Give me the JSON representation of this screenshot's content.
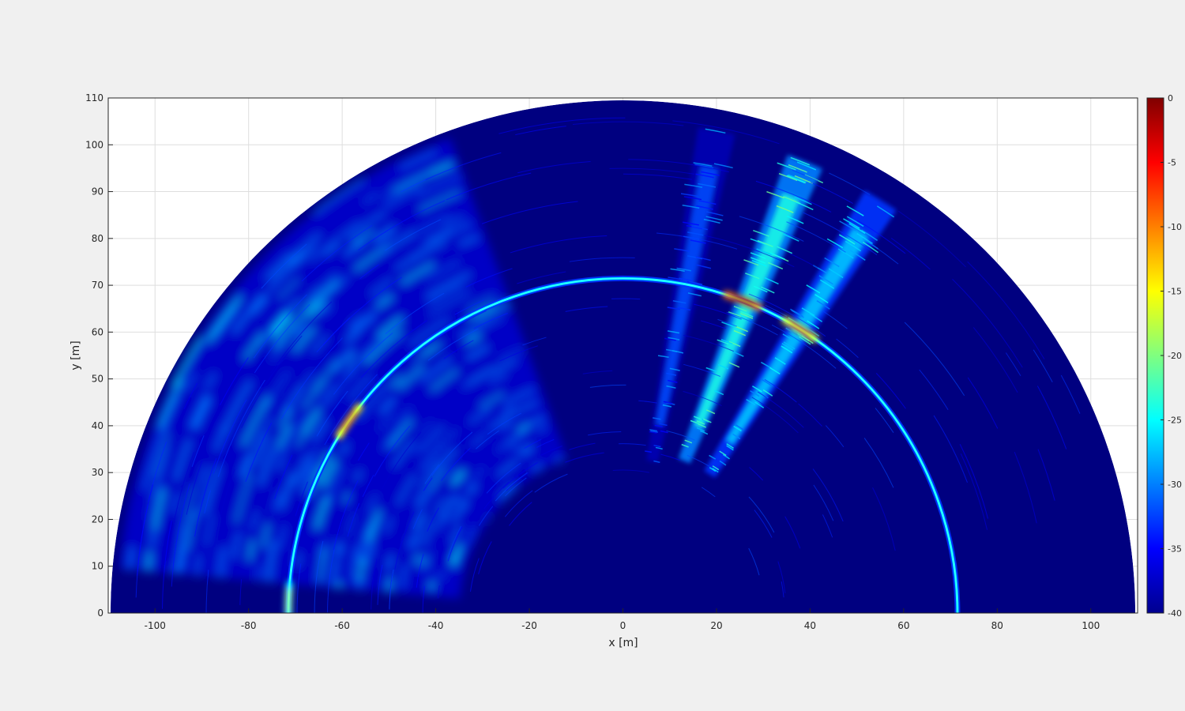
{
  "chart_data": {
    "type": "heatmap",
    "title": "",
    "xlabel": "x [m]",
    "ylabel": "y [m]",
    "xlim": [
      -110,
      110
    ],
    "ylim": [
      0,
      110
    ],
    "xticks": [
      -100,
      -80,
      -60,
      -40,
      -20,
      0,
      20,
      40,
      60,
      80,
      100
    ],
    "yticks": [
      0,
      10,
      20,
      30,
      40,
      50,
      60,
      70,
      80,
      90,
      100,
      110
    ],
    "grid": true,
    "colormap": "jet",
    "clim": [
      -40,
      0
    ],
    "colorbar_ticks": [
      0,
      -5,
      -10,
      -15,
      -20,
      -25,
      -30,
      -35,
      -40
    ],
    "colorbar_position": "right",
    "max_range_m": 109.5,
    "background_level_db": -40,
    "features": [
      {
        "kind": "range_ring",
        "radius_m": 71.5,
        "level_db": -25
      },
      {
        "kind": "beam",
        "angle_deg": 68,
        "r_min_m": 35,
        "r_max_m": 104,
        "level_db": -24
      },
      {
        "kind": "beam",
        "angle_deg": 58,
        "r_min_m": 35,
        "r_max_m": 104,
        "level_db": -27
      },
      {
        "kind": "beam",
        "angle_deg": 79,
        "r_min_m": 33,
        "r_max_m": 105,
        "level_db": -32
      },
      {
        "kind": "clutter_sector",
        "angle_min_deg": 110,
        "angle_max_deg": 175,
        "r_min_m": 35,
        "r_max_m": 108,
        "level_db": -30
      },
      {
        "kind": "hotspot",
        "angle_deg": 69,
        "radius_m": 71.5,
        "level_db": -2
      },
      {
        "kind": "hotspot",
        "angle_deg": 58,
        "radius_m": 71.5,
        "level_db": -8
      },
      {
        "kind": "hotspot",
        "angle_deg": 145,
        "radius_m": 71.5,
        "level_db": -7
      },
      {
        "kind": "hotspot",
        "angle_deg": 178,
        "radius_m": 71.5,
        "level_db": -18
      }
    ]
  }
}
